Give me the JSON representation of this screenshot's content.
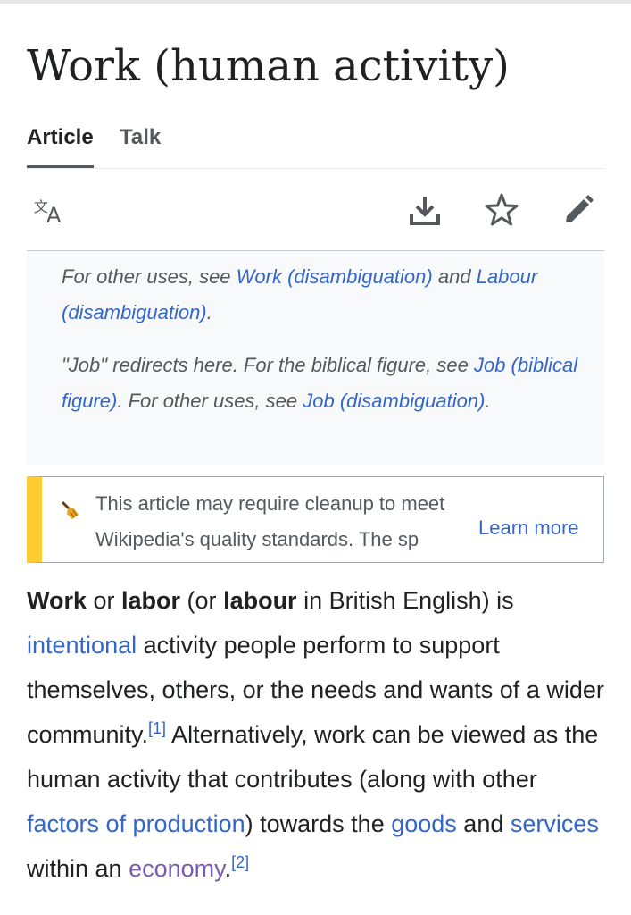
{
  "page": {
    "title": "Work (human activity)"
  },
  "tabs": [
    {
      "label": "Article",
      "active": true
    },
    {
      "label": "Talk",
      "active": false
    }
  ],
  "toolbar": {
    "language_icon": "translate-icon",
    "download_icon": "download-icon",
    "watch_icon": "star-icon",
    "edit_icon": "pencil-icon"
  },
  "hatnotes": {
    "first": {
      "prefix": "For other uses, see ",
      "link1": "Work (disambiguation)",
      "middle": " and ",
      "link2": "Labour (disambiguation)",
      "suffix": "."
    },
    "second": {
      "prefix": "\"Job\" redirects here. For the biblical figure, see ",
      "link1": "Job (biblical figure)",
      "middle": ". For other uses, see ",
      "link2": "Job (disambiguation)",
      "suffix": "."
    }
  },
  "notice": {
    "icon": "broom-icon",
    "text": "This article may require cleanup to meet Wikipedia's quality standards. The sp",
    "learn_more": "Learn more",
    "accent_color": "#ffcc33"
  },
  "article": {
    "t1": "Work",
    "t2": " or ",
    "t3": "labor",
    "t4": " (or ",
    "t5": "labour",
    "t6": " in British English) is ",
    "link_intentional": "intentional",
    "t7": " activity people perform to support themselves, others, or the needs and wants of a wider community.",
    "ref1": "[1]",
    "t8": " Alternatively, work can be viewed as the human activity that contributes (along with other ",
    "link_factors": "factors of production",
    "t9": ") towards the ",
    "link_goods": "goods",
    "t10": " and ",
    "link_services": "services",
    "t11": " within an ",
    "link_economy": "economy",
    "t12": ".",
    "ref2": "[2]"
  },
  "colors": {
    "link": "#3366cc",
    "visited_link": "#795cb2",
    "text": "#202122"
  }
}
